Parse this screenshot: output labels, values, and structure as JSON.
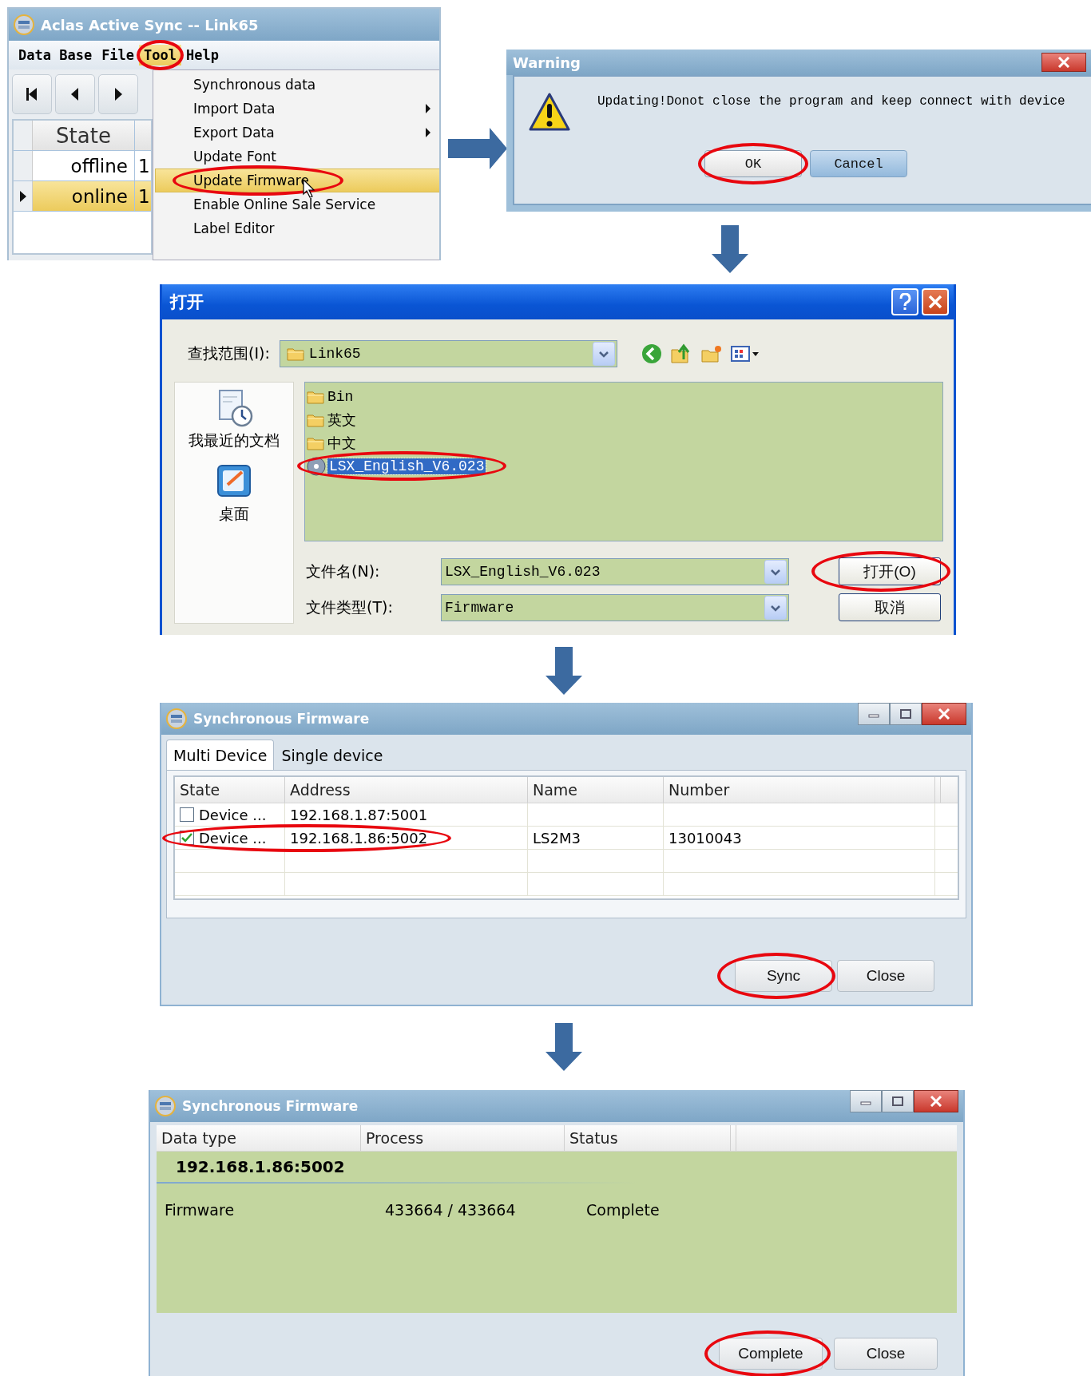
{
  "main_window": {
    "title": "Aclas Active Sync -- Link65",
    "menu": [
      {
        "label": "Data Base",
        "selected": false,
        "highlighted": false
      },
      {
        "label": "File",
        "selected": false,
        "highlighted": false
      },
      {
        "label": "Tool",
        "selected": true,
        "highlighted": true
      },
      {
        "label": "Help",
        "selected": false,
        "highlighted": false
      }
    ],
    "grid": {
      "columns": [
        "State"
      ],
      "rows": [
        {
          "state": "offline",
          "column_2": "1",
          "selected": false
        },
        {
          "state": "online",
          "column_2": "1",
          "selected": true
        }
      ]
    },
    "tool_menu": [
      {
        "label": "Synchronous data",
        "submenu": false,
        "selected": false,
        "highlighted": false
      },
      {
        "label": "Import Data",
        "submenu": true,
        "selected": false,
        "highlighted": false
      },
      {
        "label": "Export Data",
        "submenu": true,
        "selected": false,
        "highlighted": false
      },
      {
        "label": "Update Font",
        "submenu": false,
        "selected": false,
        "highlighted": false
      },
      {
        "label": "Update Firmware",
        "submenu": false,
        "selected": true,
        "highlighted": true
      },
      {
        "label": "Enable Online Sale Service",
        "submenu": false,
        "selected": false,
        "highlighted": false
      },
      {
        "label": "Label Editor",
        "submenu": false,
        "selected": false,
        "highlighted": false
      }
    ]
  },
  "warning_dialog": {
    "title": "Warning",
    "message": "Updating!Donot close the program and keep connect with device",
    "buttons": [
      {
        "label": "OK",
        "default": true,
        "highlighted": true
      },
      {
        "label": "Cancel",
        "default": false,
        "highlighted": false
      }
    ]
  },
  "open_dialog": {
    "title": "打开",
    "look_in_label": "查找范围(I):",
    "look_in": "Link65",
    "places": [
      {
        "label": "我最近的文档",
        "kind": "recent"
      },
      {
        "label": "桌面",
        "kind": "desktop"
      }
    ],
    "files": [
      {
        "name": "Bin",
        "kind": "folder",
        "selected": false,
        "highlighted": false
      },
      {
        "name": "英文",
        "kind": "folder",
        "selected": false,
        "highlighted": false
      },
      {
        "name": "中文",
        "kind": "folder",
        "selected": false,
        "highlighted": false
      },
      {
        "name": "LSX_English_V6.023",
        "kind": "file",
        "selected": true,
        "highlighted": true
      }
    ],
    "file_name_label": "文件名(N):",
    "file_name": "LSX_English_V6.023",
    "file_type_label": "文件类型(T):",
    "file_type": "Firmware",
    "buttons": [
      {
        "label": "打开(O)",
        "highlighted": true
      },
      {
        "label": "取消",
        "highlighted": false
      }
    ]
  },
  "sync_dialog": {
    "title": "Synchronous Firmware",
    "tabs": [
      {
        "label": "Multi Device",
        "selected": true
      },
      {
        "label": "Single device",
        "selected": false
      }
    ],
    "columns": [
      "State",
      "Address",
      "Name",
      "Number"
    ],
    "rows": [
      {
        "checked": false,
        "highlighted": false,
        "state": "Device ...",
        "address": "192.168.1.87:5001"
      },
      {
        "checked": true,
        "highlighted": true,
        "state": "Device ...",
        "address": "192.168.1.86:5002",
        "name": "LS2M3",
        "number": "13010043"
      }
    ],
    "buttons": [
      {
        "label": "Sync",
        "highlighted": true
      },
      {
        "label": "Close",
        "highlighted": false
      }
    ]
  },
  "result_dialog": {
    "title": "Synchronous Firmware",
    "columns": [
      "Data type",
      "Process",
      "Status"
    ],
    "group": "192.168.1.86:5002",
    "rows": [
      {
        "data_type": "Firmware",
        "process": "433664 / 433664",
        "status": "Complete"
      }
    ],
    "buttons": [
      {
        "label": "Complete",
        "highlighted": true
      },
      {
        "label": "Close",
        "highlighted": false
      }
    ]
  }
}
